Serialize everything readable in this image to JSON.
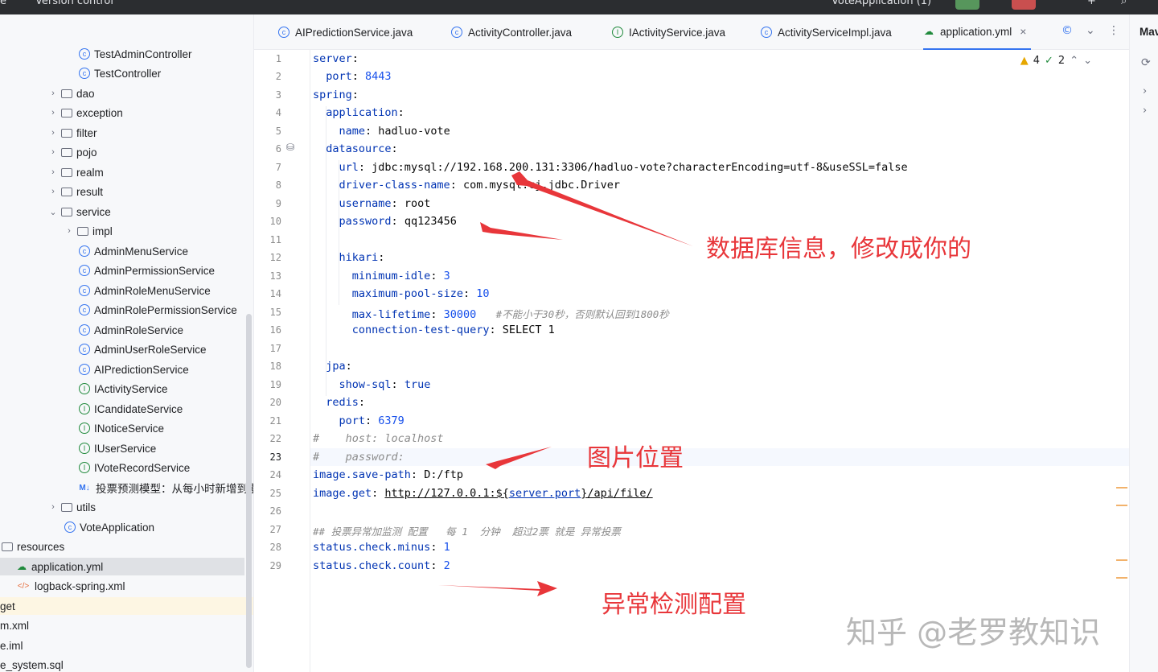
{
  "topbar": {
    "menu_left": "e",
    "vcs": "Version control",
    "run_config": "VoteApplication (1)"
  },
  "tabs": [
    {
      "label": "AIPredictionService.java",
      "icon": "class-icon"
    },
    {
      "label": "ActivityController.java",
      "icon": "class-icon"
    },
    {
      "label": "IActivityService.java",
      "icon": "interface-icon"
    },
    {
      "label": "ActivityServiceImpl.java",
      "icon": "class-icon"
    },
    {
      "label": "application.yml",
      "icon": "yaml-icon",
      "active": true
    }
  ],
  "tree": {
    "items": [
      {
        "label": "TestAdminController",
        "icon": "class"
      },
      {
        "label": "TestController",
        "icon": "class"
      },
      {
        "label": "dao",
        "icon": "folder"
      },
      {
        "label": "exception",
        "icon": "folder"
      },
      {
        "label": "filter",
        "icon": "folder"
      },
      {
        "label": "pojo",
        "icon": "folder"
      },
      {
        "label": "realm",
        "icon": "folder"
      },
      {
        "label": "result",
        "icon": "folder"
      },
      {
        "label": "service",
        "icon": "folder"
      },
      {
        "label": "impl",
        "icon": "folder"
      },
      {
        "label": "AdminMenuService",
        "icon": "class"
      },
      {
        "label": "AdminPermissionService",
        "icon": "class"
      },
      {
        "label": "AdminRoleMenuService",
        "icon": "class"
      },
      {
        "label": "AdminRolePermissionService",
        "icon": "class"
      },
      {
        "label": "AdminRoleService",
        "icon": "class"
      },
      {
        "label": "AdminUserRoleService",
        "icon": "class"
      },
      {
        "label": "AIPredictionService",
        "icon": "class"
      },
      {
        "label": "IActivityService",
        "icon": "interface"
      },
      {
        "label": "ICandidateService",
        "icon": "interface"
      },
      {
        "label": "INoticeService",
        "icon": "interface"
      },
      {
        "label": "IUserService",
        "icon": "interface"
      },
      {
        "label": "IVoteRecordService",
        "icon": "interface"
      },
      {
        "label": "投票预测模型：从每小时新增到累计",
        "icon": "markdown"
      },
      {
        "label": "utils",
        "icon": "folder"
      },
      {
        "label": "VoteApplication",
        "icon": "app"
      },
      {
        "label": "resources",
        "icon": "folder"
      },
      {
        "label": "application.yml",
        "icon": "yaml"
      },
      {
        "label": "logback-spring.xml",
        "icon": "xml"
      },
      {
        "label": "get",
        "icon": "none"
      },
      {
        "label": "m.xml",
        "icon": "none"
      },
      {
        "label": "e.iml",
        "icon": "none"
      },
      {
        "label": "e_system.sql",
        "icon": "none"
      }
    ]
  },
  "editor": {
    "line_numbers": [
      "1",
      "2",
      "3",
      "4",
      "5",
      "6",
      "7",
      "8",
      "9",
      "10",
      "11",
      "12",
      "13",
      "14",
      "15",
      "16",
      "17",
      "18",
      "19",
      "20",
      "21",
      "22",
      "23",
      "24",
      "25",
      "26",
      "27",
      "28",
      "29"
    ],
    "warnings": "4",
    "checks": "2",
    "lines": {
      "l1_k": "server",
      "l2_k": "port",
      "l2_v": "8443",
      "l3_k": "spring",
      "l4_k": "application",
      "l5_k": "name",
      "l5_v": "hadluo-vote",
      "l6_k": "datasource",
      "l7_k": "url",
      "l7_v": "jdbc:mysql://192.168.200.131:3306/hadluo-vote?characterEncoding=utf-8&useSSL=false",
      "l8_k": "driver-class-name",
      "l8_v": "com.mysql.cj.jdbc.Driver",
      "l9_k": "username",
      "l9_v": "root",
      "l10_k": "password",
      "l10_v": "qq123456",
      "l12_k": "hikari",
      "l13_k": "minimum-idle",
      "l13_v": "3",
      "l14_k": "maximum-pool-size",
      "l14_v": "10",
      "l15_k": "max-lifetime",
      "l15_v": "30000",
      "l15_c": "#不能小于30秒，否则默认回到1800秒",
      "l16_k": "connection-test-query",
      "l16_v": "SELECT 1",
      "l18_k": "jpa",
      "l19_k": "show-sql",
      "l19_v": "true",
      "l20_k": "redis",
      "l21_k": "port",
      "l21_v": "6379",
      "l22_c": "#    host: localhost",
      "l23_c": "#    password:",
      "l24_k": "image.save-path",
      "l24_v": "D:/ftp",
      "l25_k": "image.get",
      "l25_v1": "http://127.0.0.1:${",
      "l25_v2": "server.port",
      "l25_v3": "}/api/file/",
      "l27_c": "## 投票异常加监测 配置   每 1  分钟  超过2票 就是 异常投票",
      "l28_k": "status.check.minus",
      "l28_v": "1",
      "l29_k": "status.check.count",
      "l29_v": "2"
    }
  },
  "right_panel": {
    "title": "Mav"
  },
  "annotations": {
    "db": "数据库信息，修改成你的",
    "image": "图片位置",
    "check": "异常检测配置"
  },
  "watermark": "知乎 @老罗教知识",
  "colors": {
    "annotation": "#e8363a",
    "accent": "#3574f0"
  }
}
